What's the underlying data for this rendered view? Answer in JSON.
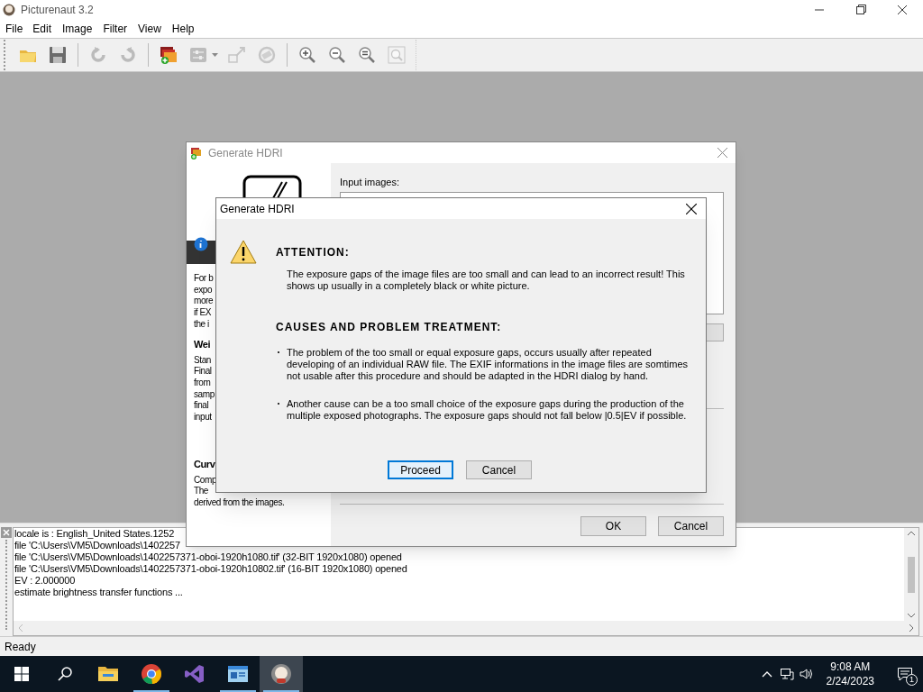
{
  "app": {
    "title": "Picturenaut 3.2"
  },
  "menu": [
    "File",
    "Edit",
    "Image",
    "Filter",
    "View",
    "Help"
  ],
  "toolbar": [
    {
      "kind": "open",
      "disabled": false
    },
    {
      "kind": "save",
      "disabled": false
    },
    {
      "kind": "sep"
    },
    {
      "kind": "undo",
      "disabled": true
    },
    {
      "kind": "redo",
      "disabled": true
    },
    {
      "kind": "sep"
    },
    {
      "kind": "hdri",
      "disabled": false
    },
    {
      "kind": "adjust",
      "disabled": true
    },
    {
      "kind": "resize",
      "disabled": true
    },
    {
      "kind": "rotate",
      "disabled": true
    },
    {
      "kind": "sep"
    },
    {
      "kind": "zoom-in",
      "disabled": false
    },
    {
      "kind": "zoom-out",
      "disabled": false
    },
    {
      "kind": "zoom-actual",
      "disabled": false
    },
    {
      "kind": "zoom-fit",
      "disabled": true
    }
  ],
  "background_dialog": {
    "title": "Generate HDRI",
    "left_text": [
      {
        "kind": "text",
        "text": "For b"
      },
      {
        "kind": "text",
        "text": "expo"
      },
      {
        "kind": "text",
        "text": "more"
      },
      {
        "kind": "text",
        "text": "if EX"
      },
      {
        "kind": "text",
        "text": "the i"
      },
      {
        "kind": "heading",
        "text": "Wei"
      },
      {
        "kind": "text",
        "text": "Stan"
      },
      {
        "kind": "text",
        "text": "Final"
      },
      {
        "kind": "text",
        "text": "from"
      },
      {
        "kind": "text",
        "text": "samp"
      },
      {
        "kind": "text",
        "text": "final"
      },
      {
        "kind": "text",
        "text": "input"
      },
      {
        "kind": "gap"
      },
      {
        "kind": "heading",
        "text": "Curv"
      },
      {
        "kind": "text",
        "text": "Comp"
      },
      {
        "kind": "text",
        "text": "The"
      },
      {
        "kind": "text",
        "text": "derived from the images."
      }
    ],
    "input_label": "Input images:",
    "buttons": [
      "OK",
      "Cancel"
    ]
  },
  "alert_dialog": {
    "title": "Generate HDRI",
    "attention_heading": "ATTENTION:",
    "attention_text": "The exposure gaps of the image files are too small and can lead to an incorrect result! This shows up usually in a completely black or white picture.",
    "causes_heading": "CAUSES AND PROBLEM TREATMENT:",
    "causes": [
      "The problem of the too small or equal exposure gaps, occurs usually after repeated developing of an individual RAW file. The EXIF informations in the image files are somtimes not usable after this procedure and should be adapted in the HDRI dialog by hand.",
      "Another cause can be a too small choice of the exposure gaps during the production of the multiple exposed photographs. The exposure gaps should not fall below |0.5|EV if possible."
    ],
    "buttons": [
      {
        "label": "Proceed",
        "selected": true
      },
      {
        "label": "Cancel",
        "selected": false
      }
    ]
  },
  "log": [
    "locale is : English_United States.1252",
    "file 'C:\\Users\\VM5\\Downloads\\1402257",
    "file 'C:\\Users\\VM5\\Downloads\\1402257371-oboi-1920h1080.tif' (32-BIT 1920x1080) opened",
    "file 'C:\\Users\\VM5\\Downloads\\1402257371-oboi-1920h10802.tif' (16-BIT 1920x1080) opened",
    "EV : 2.000000",
    "estimate brightness transfer functions ..."
  ],
  "status_bar": "Ready",
  "taskbar": {
    "apps": [
      {
        "kind": "explorer",
        "running": false,
        "selected": false
      },
      {
        "kind": "chrome",
        "running": true,
        "selected": false
      },
      {
        "kind": "studio",
        "running": false,
        "selected": false
      },
      {
        "kind": "panel",
        "running": true,
        "selected": false
      },
      {
        "kind": "picturenaut",
        "running": true,
        "selected": true
      }
    ],
    "time": "9:08 AM",
    "date": "2/24/2023",
    "notifications": "1"
  }
}
